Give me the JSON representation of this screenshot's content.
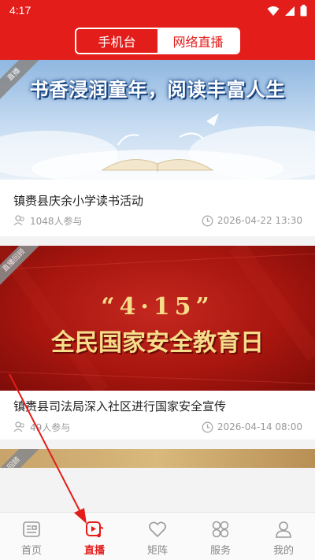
{
  "status_bar": {
    "time": "4:17"
  },
  "header": {
    "tabs": [
      {
        "label": "手机台"
      },
      {
        "label": "网络直播"
      }
    ]
  },
  "cards": [
    {
      "banner_title": "书香浸润童年，阅读丰富人生",
      "corner_label": "直播",
      "title": "镇赉县庆余小学读书活动",
      "participants": "1048人参与",
      "datetime": "2026-04-22 13:30"
    },
    {
      "banner_line1": "“4·15”",
      "banner_line2": "全民国家安全教育日",
      "corner_label": "直播回顾",
      "title": "镇赉县司法局深入社区进行国家安全宣传",
      "participants": "49人参与",
      "datetime": "2026-04-14 08:00"
    },
    {
      "corner_label": "回顾"
    }
  ],
  "tabbar": {
    "items": [
      {
        "label": "首页"
      },
      {
        "label": "直播"
      },
      {
        "label": "矩阵"
      },
      {
        "label": "服务"
      },
      {
        "label": "我的"
      }
    ],
    "active": "直播"
  },
  "colors": {
    "brand": "#e31d1a",
    "inactive": "#888888"
  }
}
